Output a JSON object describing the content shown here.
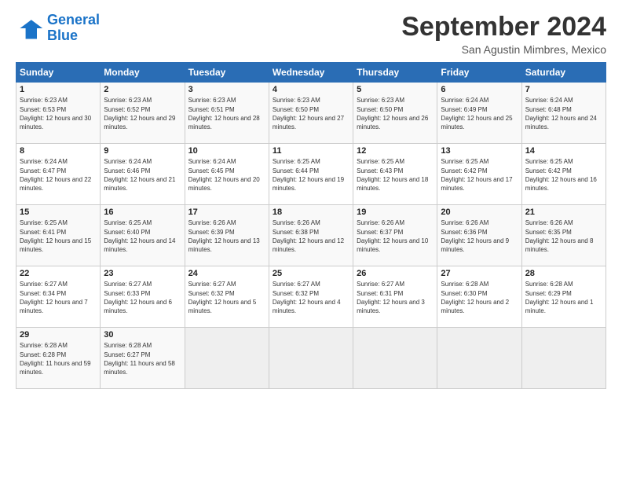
{
  "logo": {
    "line1": "General",
    "line2": "Blue"
  },
  "title": "September 2024",
  "location": "San Agustin Mimbres, Mexico",
  "days_of_week": [
    "Sunday",
    "Monday",
    "Tuesday",
    "Wednesday",
    "Thursday",
    "Friday",
    "Saturday"
  ],
  "weeks": [
    [
      {
        "day": "1",
        "info": "Sunrise: 6:23 AM\nSunset: 6:53 PM\nDaylight: 12 hours and 30 minutes."
      },
      {
        "day": "2",
        "info": "Sunrise: 6:23 AM\nSunset: 6:52 PM\nDaylight: 12 hours and 29 minutes."
      },
      {
        "day": "3",
        "info": "Sunrise: 6:23 AM\nSunset: 6:51 PM\nDaylight: 12 hours and 28 minutes."
      },
      {
        "day": "4",
        "info": "Sunrise: 6:23 AM\nSunset: 6:50 PM\nDaylight: 12 hours and 27 minutes."
      },
      {
        "day": "5",
        "info": "Sunrise: 6:23 AM\nSunset: 6:50 PM\nDaylight: 12 hours and 26 minutes."
      },
      {
        "day": "6",
        "info": "Sunrise: 6:24 AM\nSunset: 6:49 PM\nDaylight: 12 hours and 25 minutes."
      },
      {
        "day": "7",
        "info": "Sunrise: 6:24 AM\nSunset: 6:48 PM\nDaylight: 12 hours and 24 minutes."
      }
    ],
    [
      {
        "day": "8",
        "info": "Sunrise: 6:24 AM\nSunset: 6:47 PM\nDaylight: 12 hours and 22 minutes."
      },
      {
        "day": "9",
        "info": "Sunrise: 6:24 AM\nSunset: 6:46 PM\nDaylight: 12 hours and 21 minutes."
      },
      {
        "day": "10",
        "info": "Sunrise: 6:24 AM\nSunset: 6:45 PM\nDaylight: 12 hours and 20 minutes."
      },
      {
        "day": "11",
        "info": "Sunrise: 6:25 AM\nSunset: 6:44 PM\nDaylight: 12 hours and 19 minutes."
      },
      {
        "day": "12",
        "info": "Sunrise: 6:25 AM\nSunset: 6:43 PM\nDaylight: 12 hours and 18 minutes."
      },
      {
        "day": "13",
        "info": "Sunrise: 6:25 AM\nSunset: 6:42 PM\nDaylight: 12 hours and 17 minutes."
      },
      {
        "day": "14",
        "info": "Sunrise: 6:25 AM\nSunset: 6:42 PM\nDaylight: 12 hours and 16 minutes."
      }
    ],
    [
      {
        "day": "15",
        "info": "Sunrise: 6:25 AM\nSunset: 6:41 PM\nDaylight: 12 hours and 15 minutes."
      },
      {
        "day": "16",
        "info": "Sunrise: 6:25 AM\nSunset: 6:40 PM\nDaylight: 12 hours and 14 minutes."
      },
      {
        "day": "17",
        "info": "Sunrise: 6:26 AM\nSunset: 6:39 PM\nDaylight: 12 hours and 13 minutes."
      },
      {
        "day": "18",
        "info": "Sunrise: 6:26 AM\nSunset: 6:38 PM\nDaylight: 12 hours and 12 minutes."
      },
      {
        "day": "19",
        "info": "Sunrise: 6:26 AM\nSunset: 6:37 PM\nDaylight: 12 hours and 10 minutes."
      },
      {
        "day": "20",
        "info": "Sunrise: 6:26 AM\nSunset: 6:36 PM\nDaylight: 12 hours and 9 minutes."
      },
      {
        "day": "21",
        "info": "Sunrise: 6:26 AM\nSunset: 6:35 PM\nDaylight: 12 hours and 8 minutes."
      }
    ],
    [
      {
        "day": "22",
        "info": "Sunrise: 6:27 AM\nSunset: 6:34 PM\nDaylight: 12 hours and 7 minutes."
      },
      {
        "day": "23",
        "info": "Sunrise: 6:27 AM\nSunset: 6:33 PM\nDaylight: 12 hours and 6 minutes."
      },
      {
        "day": "24",
        "info": "Sunrise: 6:27 AM\nSunset: 6:32 PM\nDaylight: 12 hours and 5 minutes."
      },
      {
        "day": "25",
        "info": "Sunrise: 6:27 AM\nSunset: 6:32 PM\nDaylight: 12 hours and 4 minutes."
      },
      {
        "day": "26",
        "info": "Sunrise: 6:27 AM\nSunset: 6:31 PM\nDaylight: 12 hours and 3 minutes."
      },
      {
        "day": "27",
        "info": "Sunrise: 6:28 AM\nSunset: 6:30 PM\nDaylight: 12 hours and 2 minutes."
      },
      {
        "day": "28",
        "info": "Sunrise: 6:28 AM\nSunset: 6:29 PM\nDaylight: 12 hours and 1 minute."
      }
    ],
    [
      {
        "day": "29",
        "info": "Sunrise: 6:28 AM\nSunset: 6:28 PM\nDaylight: 11 hours and 59 minutes."
      },
      {
        "day": "30",
        "info": "Sunrise: 6:28 AM\nSunset: 6:27 PM\nDaylight: 11 hours and 58 minutes."
      },
      {
        "day": "",
        "info": ""
      },
      {
        "day": "",
        "info": ""
      },
      {
        "day": "",
        "info": ""
      },
      {
        "day": "",
        "info": ""
      },
      {
        "day": "",
        "info": ""
      }
    ]
  ]
}
